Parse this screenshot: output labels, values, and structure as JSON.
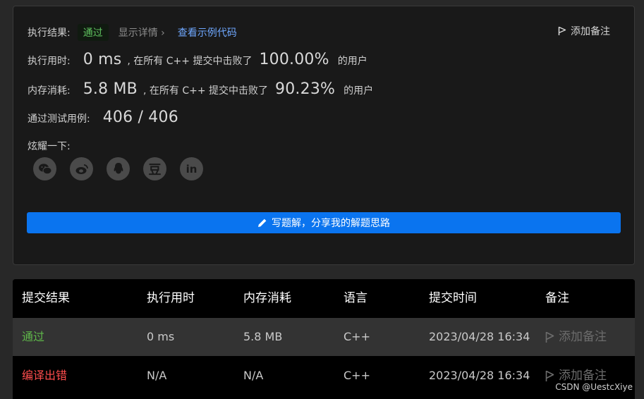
{
  "result": {
    "label": "执行结果:",
    "status": "通过",
    "details": "显示详情 ›",
    "example": "查看示例代码",
    "add_note": "添加备注"
  },
  "runtime": {
    "label": "执行用时:",
    "value": "0 ms",
    "text": ", 在所有 C++ 提交中击败了",
    "percent": "100.00%",
    "suffix": "的用户"
  },
  "memory": {
    "label": "内存消耗:",
    "value": "5.8 MB",
    "text": ", 在所有 C++ 提交中击败了",
    "percent": "90.23%",
    "suffix": "的用户"
  },
  "testcases": {
    "label": "通过测试用例:",
    "value": "406 / 406"
  },
  "share": {
    "label": "炫耀一下:",
    "icons": [
      "wechat-icon",
      "weibo-icon",
      "qq-icon",
      "douban-icon",
      "linkedin-icon"
    ],
    "douban_glyph": "豆",
    "linkedin_glyph": "in"
  },
  "write_button": "写题解，分享我的解题思路",
  "table": {
    "headers": [
      "提交结果",
      "执行用时",
      "内存消耗",
      "语言",
      "提交时间",
      "备注"
    ],
    "rows": [
      {
        "result": "通过",
        "time": "0 ms",
        "memory": "5.8 MB",
        "lang": "C++",
        "submitted": "2023/04/28 16:34",
        "note": "添加备注"
      },
      {
        "result": "编译出错",
        "time": "N/A",
        "memory": "N/A",
        "lang": "C++",
        "submitted": "2023/04/28 16:34",
        "note": "添加备注"
      }
    ]
  },
  "watermark": "CSDN @UestcXiye",
  "colors": {
    "accent": "#0a74ef",
    "pass": "#5fb84a",
    "fail": "#ff4d4d",
    "link": "#6fa8ff"
  }
}
